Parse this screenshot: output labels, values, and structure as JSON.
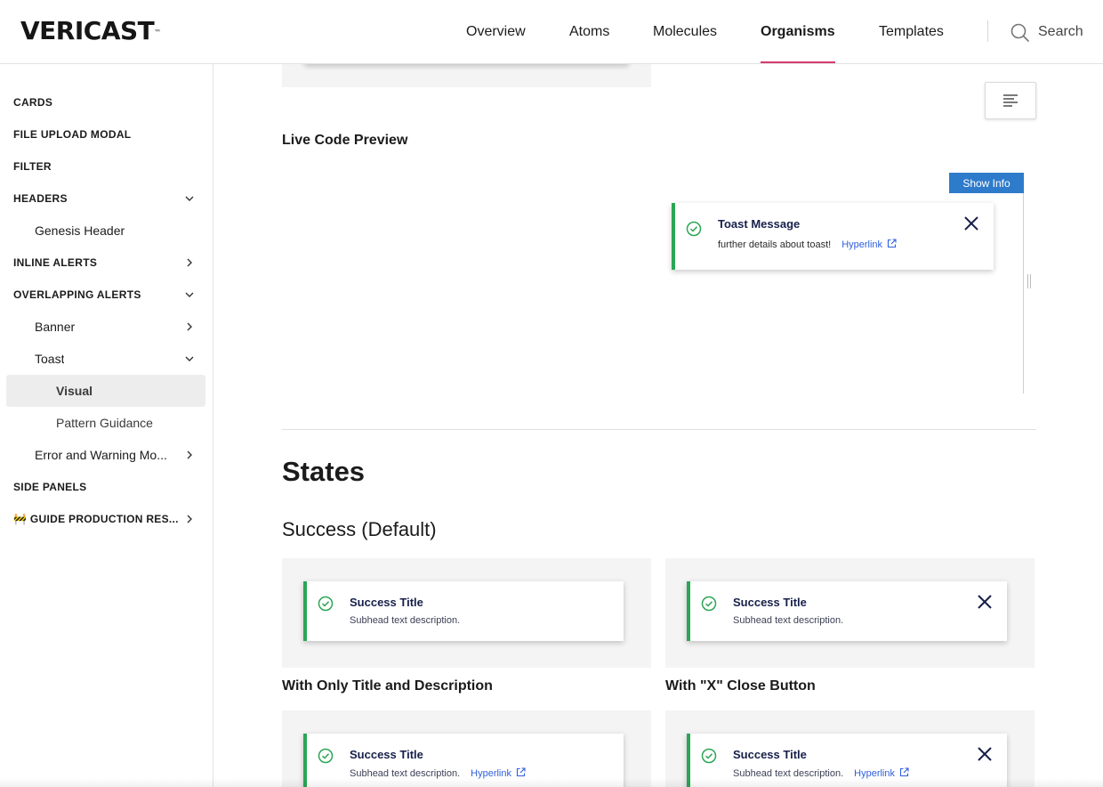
{
  "brand": {
    "logo": "VERICAST",
    "trademark": "™"
  },
  "nav": {
    "items": [
      {
        "label": "Overview",
        "active": false
      },
      {
        "label": "Atoms",
        "active": false
      },
      {
        "label": "Molecules",
        "active": false
      },
      {
        "label": "Organisms",
        "active": true
      },
      {
        "label": "Templates",
        "active": false
      }
    ],
    "search_label": "Search",
    "accent_color": "#d63a6d"
  },
  "sidebar": {
    "items": [
      {
        "label": "CARDS",
        "level": 0,
        "chevron": "none"
      },
      {
        "label": "FILE UPLOAD MODAL",
        "level": 0,
        "chevron": "none"
      },
      {
        "label": "FILTER",
        "level": 0,
        "chevron": "none"
      },
      {
        "label": "HEADERS",
        "level": 0,
        "chevron": "down"
      },
      {
        "label": "Genesis Header",
        "level": 1,
        "chevron": "none"
      },
      {
        "label": "INLINE ALERTS",
        "level": 0,
        "chevron": "right"
      },
      {
        "label": "OVERLAPPING ALERTS",
        "level": 0,
        "chevron": "down"
      },
      {
        "label": "Banner",
        "level": 1,
        "chevron": "right"
      },
      {
        "label": "Toast",
        "level": 1,
        "chevron": "down"
      },
      {
        "label": "Visual",
        "level": 2,
        "chevron": "none",
        "selected": true
      },
      {
        "label": "Pattern Guidance",
        "level": 2,
        "chevron": "none"
      },
      {
        "label": "Error and Warning Mo...",
        "level": 1,
        "chevron": "right"
      },
      {
        "label": "SIDE PANELS",
        "level": 0,
        "chevron": "none"
      },
      {
        "label": "🚧 GUIDE PRODUCTION RES...",
        "level": 0,
        "chevron": "right"
      }
    ]
  },
  "main": {
    "live_preview_title": "Live Code Preview",
    "show_info_label": "Show Info",
    "live_toast": {
      "title": "Toast Message",
      "description": "further details about toast!",
      "link": "Hyperlink"
    },
    "states_heading": "States",
    "success_heading": "Success (Default)",
    "cards": [
      {
        "title": "Success Title",
        "description": "Subhead text description.",
        "link": "",
        "close": false,
        "caption": "With Only Title and Description"
      },
      {
        "title": "Success Title",
        "description": "Subhead text description.",
        "link": "",
        "close": true,
        "caption": "With \"X\" Close Button"
      },
      {
        "title": "Success Title",
        "description": "Subhead text description.",
        "link": "Hyperlink",
        "close": false,
        "caption": ""
      },
      {
        "title": "Success Title",
        "description": "Subhead text description.",
        "link": "Hyperlink",
        "close": true,
        "caption": ""
      }
    ],
    "colors": {
      "success": "#2aa654",
      "info_button": "#2f7bcb",
      "link": "#2f5fdc",
      "title": "#17204a"
    }
  }
}
